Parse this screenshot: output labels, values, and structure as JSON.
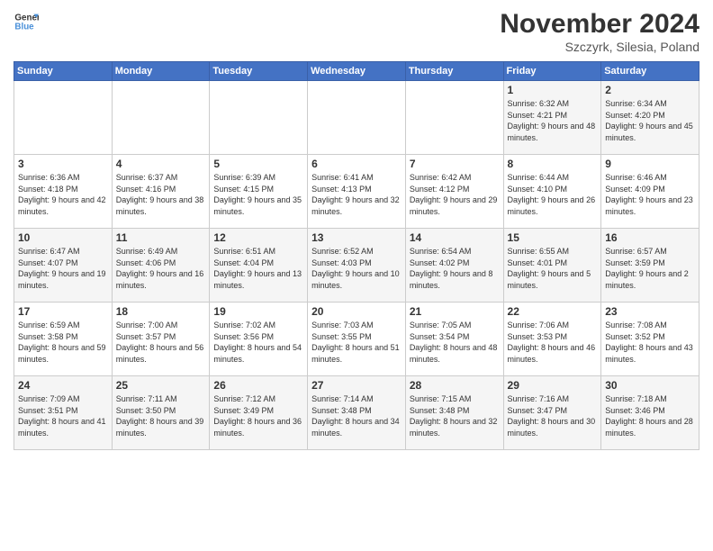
{
  "logo": {
    "line1": "General",
    "line2": "Blue"
  },
  "header": {
    "month": "November 2024",
    "location": "Szczyrk, Silesia, Poland"
  },
  "weekdays": [
    "Sunday",
    "Monday",
    "Tuesday",
    "Wednesday",
    "Thursday",
    "Friday",
    "Saturday"
  ],
  "weeks": [
    [
      {
        "day": "",
        "info": ""
      },
      {
        "day": "",
        "info": ""
      },
      {
        "day": "",
        "info": ""
      },
      {
        "day": "",
        "info": ""
      },
      {
        "day": "",
        "info": ""
      },
      {
        "day": "1",
        "info": "Sunrise: 6:32 AM\nSunset: 4:21 PM\nDaylight: 9 hours and 48 minutes."
      },
      {
        "day": "2",
        "info": "Sunrise: 6:34 AM\nSunset: 4:20 PM\nDaylight: 9 hours and 45 minutes."
      }
    ],
    [
      {
        "day": "3",
        "info": "Sunrise: 6:36 AM\nSunset: 4:18 PM\nDaylight: 9 hours and 42 minutes."
      },
      {
        "day": "4",
        "info": "Sunrise: 6:37 AM\nSunset: 4:16 PM\nDaylight: 9 hours and 38 minutes."
      },
      {
        "day": "5",
        "info": "Sunrise: 6:39 AM\nSunset: 4:15 PM\nDaylight: 9 hours and 35 minutes."
      },
      {
        "day": "6",
        "info": "Sunrise: 6:41 AM\nSunset: 4:13 PM\nDaylight: 9 hours and 32 minutes."
      },
      {
        "day": "7",
        "info": "Sunrise: 6:42 AM\nSunset: 4:12 PM\nDaylight: 9 hours and 29 minutes."
      },
      {
        "day": "8",
        "info": "Sunrise: 6:44 AM\nSunset: 4:10 PM\nDaylight: 9 hours and 26 minutes."
      },
      {
        "day": "9",
        "info": "Sunrise: 6:46 AM\nSunset: 4:09 PM\nDaylight: 9 hours and 23 minutes."
      }
    ],
    [
      {
        "day": "10",
        "info": "Sunrise: 6:47 AM\nSunset: 4:07 PM\nDaylight: 9 hours and 19 minutes."
      },
      {
        "day": "11",
        "info": "Sunrise: 6:49 AM\nSunset: 4:06 PM\nDaylight: 9 hours and 16 minutes."
      },
      {
        "day": "12",
        "info": "Sunrise: 6:51 AM\nSunset: 4:04 PM\nDaylight: 9 hours and 13 minutes."
      },
      {
        "day": "13",
        "info": "Sunrise: 6:52 AM\nSunset: 4:03 PM\nDaylight: 9 hours and 10 minutes."
      },
      {
        "day": "14",
        "info": "Sunrise: 6:54 AM\nSunset: 4:02 PM\nDaylight: 9 hours and 8 minutes."
      },
      {
        "day": "15",
        "info": "Sunrise: 6:55 AM\nSunset: 4:01 PM\nDaylight: 9 hours and 5 minutes."
      },
      {
        "day": "16",
        "info": "Sunrise: 6:57 AM\nSunset: 3:59 PM\nDaylight: 9 hours and 2 minutes."
      }
    ],
    [
      {
        "day": "17",
        "info": "Sunrise: 6:59 AM\nSunset: 3:58 PM\nDaylight: 8 hours and 59 minutes."
      },
      {
        "day": "18",
        "info": "Sunrise: 7:00 AM\nSunset: 3:57 PM\nDaylight: 8 hours and 56 minutes."
      },
      {
        "day": "19",
        "info": "Sunrise: 7:02 AM\nSunset: 3:56 PM\nDaylight: 8 hours and 54 minutes."
      },
      {
        "day": "20",
        "info": "Sunrise: 7:03 AM\nSunset: 3:55 PM\nDaylight: 8 hours and 51 minutes."
      },
      {
        "day": "21",
        "info": "Sunrise: 7:05 AM\nSunset: 3:54 PM\nDaylight: 8 hours and 48 minutes."
      },
      {
        "day": "22",
        "info": "Sunrise: 7:06 AM\nSunset: 3:53 PM\nDaylight: 8 hours and 46 minutes."
      },
      {
        "day": "23",
        "info": "Sunrise: 7:08 AM\nSunset: 3:52 PM\nDaylight: 8 hours and 43 minutes."
      }
    ],
    [
      {
        "day": "24",
        "info": "Sunrise: 7:09 AM\nSunset: 3:51 PM\nDaylight: 8 hours and 41 minutes."
      },
      {
        "day": "25",
        "info": "Sunrise: 7:11 AM\nSunset: 3:50 PM\nDaylight: 8 hours and 39 minutes."
      },
      {
        "day": "26",
        "info": "Sunrise: 7:12 AM\nSunset: 3:49 PM\nDaylight: 8 hours and 36 minutes."
      },
      {
        "day": "27",
        "info": "Sunrise: 7:14 AM\nSunset: 3:48 PM\nDaylight: 8 hours and 34 minutes."
      },
      {
        "day": "28",
        "info": "Sunrise: 7:15 AM\nSunset: 3:48 PM\nDaylight: 8 hours and 32 minutes."
      },
      {
        "day": "29",
        "info": "Sunrise: 7:16 AM\nSunset: 3:47 PM\nDaylight: 8 hours and 30 minutes."
      },
      {
        "day": "30",
        "info": "Sunrise: 7:18 AM\nSunset: 3:46 PM\nDaylight: 8 hours and 28 minutes."
      }
    ]
  ]
}
